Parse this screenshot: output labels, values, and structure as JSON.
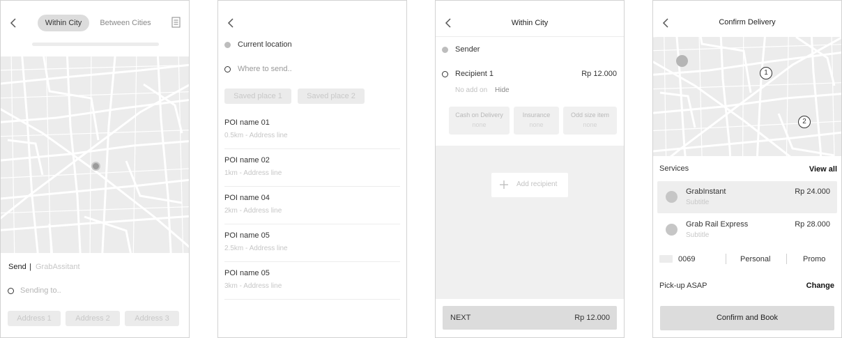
{
  "screen1": {
    "tabs": [
      {
        "label": "Within City",
        "active": true
      },
      {
        "label": "Between Cities",
        "active": false
      }
    ],
    "send_label": "Send",
    "separator": "|",
    "assistant_label": "GrabAssitant",
    "sending_placeholder": "Sending to..",
    "addresses": [
      "Address 1",
      "Address 2",
      "Address 3"
    ]
  },
  "screen2": {
    "current_location": "Current location",
    "destination_placeholder": "Where to send..",
    "saved_places": [
      "Saved place 1",
      "Saved place 2"
    ],
    "pois": [
      {
        "name": "POI name 01",
        "address": "0.5km - Address line"
      },
      {
        "name": "POI name 02",
        "address": "1km - Address line"
      },
      {
        "name": "POI name 04",
        "address": "2km - Address line"
      },
      {
        "name": "POI name 05",
        "address": "2.5km - Address line"
      },
      {
        "name": "POI name 05",
        "address": "3km - Address line"
      }
    ]
  },
  "screen3": {
    "title": "Within City",
    "sender_label": "Sender",
    "recipient_label": "Recipient 1",
    "recipient_price": "Rp 12.000",
    "addon_text": "No add on",
    "hide_label": "Hide",
    "addons": [
      {
        "title": "Cash on Delivery",
        "value": "none"
      },
      {
        "title": "Insurance",
        "value": "none"
      },
      {
        "title": "Odd size item",
        "value": "none"
      }
    ],
    "add_recipient_label": "Add recipient",
    "next_label": "NEXT",
    "next_price": "Rp 12.000"
  },
  "screen4": {
    "title": "Confirm Delivery",
    "map_markers": [
      "1",
      "2"
    ],
    "services_label": "Services",
    "view_all_label": "View all",
    "services": [
      {
        "name": "GrabInstant",
        "subtitle": "Subtitle",
        "price": "Rp 24.000",
        "selected": true
      },
      {
        "name": "Grab Rail Express",
        "subtitle": "Subtitle",
        "price": "Rp 28.000",
        "selected": false
      }
    ],
    "payment_code": "0069",
    "personal_label": "Personal",
    "promo_label": "Promo",
    "pickup_label": "Pick-up ASAP",
    "change_label": "Change",
    "confirm_label": "Confirm and Book"
  },
  "colors": {
    "map_bg": "#ececec",
    "map_road": "#ffffff",
    "active_tab_bg": "#dcdcdc",
    "selected_row_bg": "#eeeeee",
    "button_bg": "#dcdcdc"
  }
}
